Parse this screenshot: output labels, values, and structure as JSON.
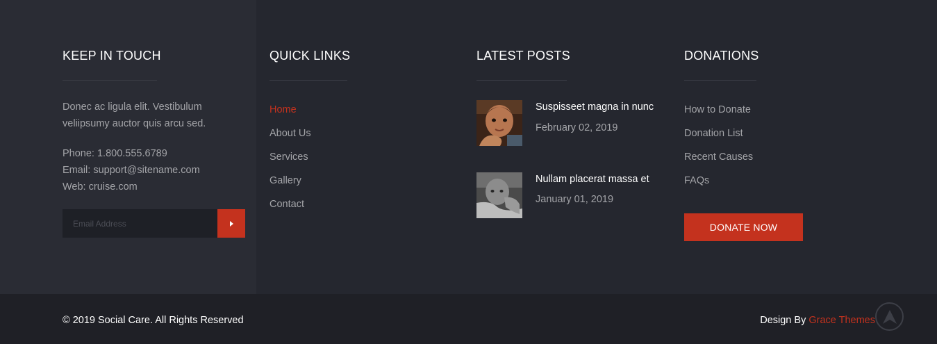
{
  "keep_in_touch": {
    "title": "KEEP IN TOUCH",
    "about_text": "Donec ac ligula elit. Vestibulum veliipsumy auctor quis arcu sed.",
    "phone": "Phone: 1.800.555.6789",
    "email": "Email: support@sitename.com",
    "web": "Web: cruise.com",
    "newsletter": {
      "placeholder": "Email Address",
      "submit_icon": "arrow-right-icon"
    }
  },
  "quick_links": {
    "title": "QUICK LINKS",
    "items": [
      {
        "label": "Home",
        "active": true
      },
      {
        "label": "About Us"
      },
      {
        "label": "Services"
      },
      {
        "label": "Gallery"
      },
      {
        "label": "Contact"
      }
    ]
  },
  "latest_posts": {
    "title": "LATEST POSTS",
    "posts": [
      {
        "title": "Suspisseet magna in nunc",
        "date": "February 02, 2019"
      },
      {
        "title": "Nullam placerat massa et",
        "date": "January 01, 2019"
      }
    ]
  },
  "donations": {
    "title": "DONATIONS",
    "items": [
      {
        "label": "How to Donate"
      },
      {
        "label": "Donation List"
      },
      {
        "label": "Recent Causes"
      },
      {
        "label": "FAQs"
      }
    ],
    "button_label": "DONATE NOW"
  },
  "bottom_bar": {
    "copyright": "© 2019 Social Care. All Rights Reserved",
    "design_by_prefix": "Design By ",
    "design_by_link": "Grace Themes",
    "back_to_top_icon": "chevron-up-circle-icon"
  },
  "colors": {
    "accent": "#c4321e",
    "background": "#25272f",
    "left_panel": "#2a2c34",
    "bottom_bar": "#1f2026",
    "text_muted": "#a3a4a8",
    "heading": "#ffffff"
  }
}
